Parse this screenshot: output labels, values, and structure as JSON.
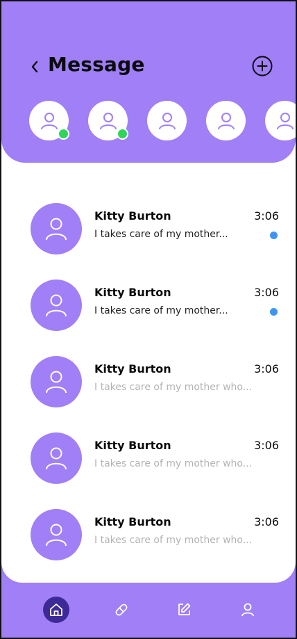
{
  "header": {
    "title": "Message",
    "back_icon": "chevron-left-icon",
    "add_icon": "plus-circle-icon"
  },
  "stories": [
    {
      "icon": "user-icon",
      "online": true
    },
    {
      "icon": "user-icon",
      "online": true
    },
    {
      "icon": "user-icon",
      "online": false
    },
    {
      "icon": "user-icon",
      "online": false
    },
    {
      "icon": "user-icon",
      "online": false
    }
  ],
  "messages": [
    {
      "name": "Kitty Burton",
      "time": "3:06",
      "preview": "I takes care of my mother...",
      "unread": true
    },
    {
      "name": "Kitty Burton",
      "time": "3:06",
      "preview": "I takes care of my mother...",
      "unread": true
    },
    {
      "name": "Kitty Burton",
      "time": "3:06",
      "preview": "I takes care of my mother who...",
      "unread": false
    },
    {
      "name": "Kitty Burton",
      "time": "3:06",
      "preview": "I takes care of my mother who...",
      "unread": false
    },
    {
      "name": "Kitty Burton",
      "time": "3:06",
      "preview": "I takes care of my mother who...",
      "unread": false
    }
  ],
  "nav": {
    "items": [
      {
        "icon": "home-icon",
        "active": true
      },
      {
        "icon": "pill-icon",
        "active": false
      },
      {
        "icon": "edit-icon",
        "active": false
      },
      {
        "icon": "profile-icon",
        "active": false
      }
    ]
  },
  "colors": {
    "primary": "#a07ff7",
    "nav_active": "#3d2a96",
    "online": "#2fd45b",
    "unread": "#3e95f0",
    "preview_read": "#b3b3b3"
  }
}
